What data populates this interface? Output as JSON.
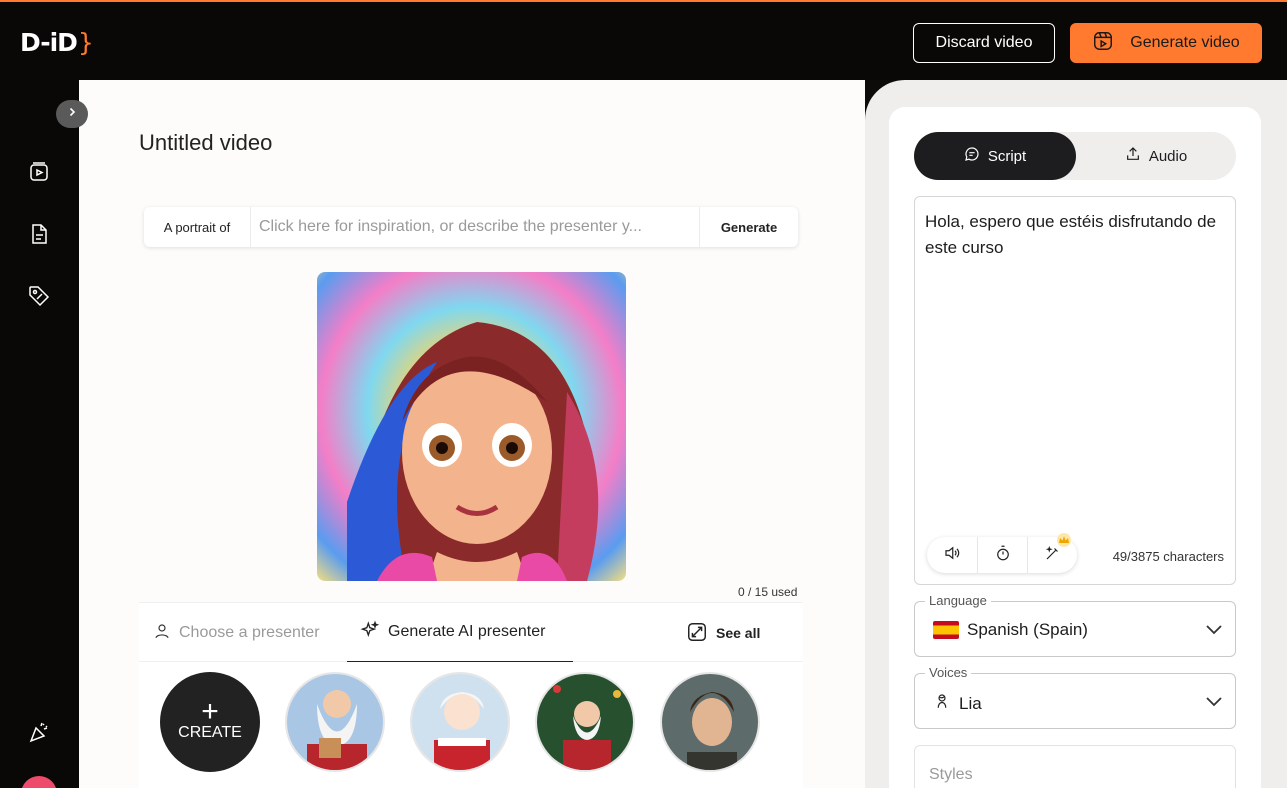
{
  "app": {
    "logo_text": "D-iD"
  },
  "header": {
    "discard_label": "Discard video",
    "generate_label": "Generate video"
  },
  "main": {
    "title": "Untitled video",
    "prompt": {
      "label": "A portrait of",
      "placeholder": "Click here for inspiration, or describe the presenter y...",
      "button": "Generate"
    },
    "usage": "0 / 15 used",
    "tabs": {
      "choose": "Choose a presenter",
      "generate": "Generate AI presenter",
      "see_all": "See all"
    },
    "create_label": "CREATE"
  },
  "right": {
    "tabs": {
      "script": "Script",
      "audio": "Audio"
    },
    "script_text": "Hola, espero que estéis disfrutando de este curso",
    "char_count": "49/3875 characters",
    "language": {
      "label": "Language",
      "value": "Spanish (Spain)"
    },
    "voices": {
      "label": "Voices",
      "value": "Lia"
    },
    "styles": {
      "placeholder": "Styles"
    }
  },
  "colors": {
    "accent": "#ff7a2e",
    "dark": "#1d1d1f"
  }
}
